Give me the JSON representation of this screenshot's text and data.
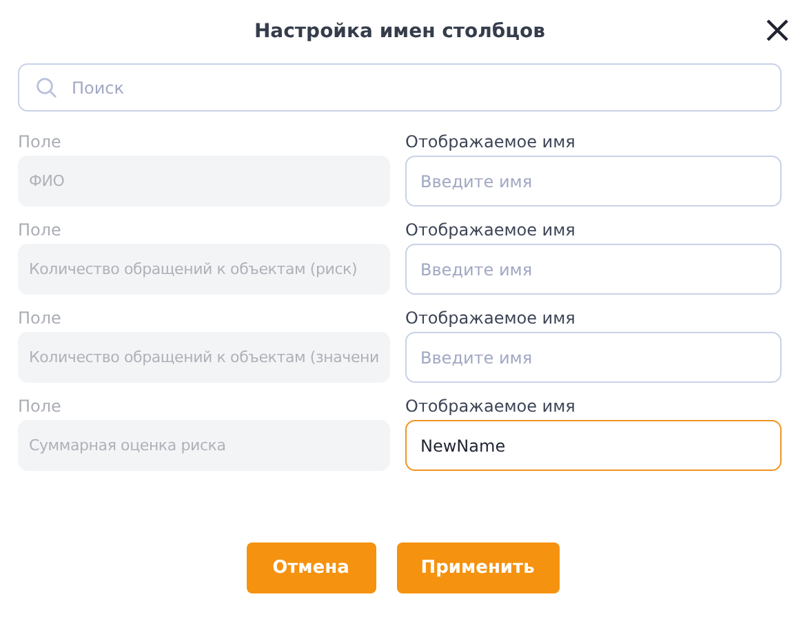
{
  "dialog": {
    "title": "Настройка имен столбцов"
  },
  "search": {
    "placeholder": "Поиск"
  },
  "rows": [
    {
      "field_label": "Поле",
      "field_value": "ФИО",
      "name_label": "Отображаемое имя",
      "placeholder": "Введите имя",
      "focused": false
    },
    {
      "field_label": "Поле",
      "field_value": "Количество обращений к объектам (риск)",
      "name_label": "Отображаемое имя",
      "placeholder": "Введите имя",
      "focused": false
    },
    {
      "field_label": "Поле",
      "field_value": "Количество обращений к объектам (значени",
      "name_label": "Отображаемое имя",
      "placeholder": "Введите имя",
      "focused": false
    },
    {
      "field_label": "Поле",
      "field_value": "Суммарная оценка риска",
      "name_label": "Отображаемое имя",
      "value": "NewName",
      "focused": true
    }
  ],
  "buttons": [
    {
      "label": "Отмена"
    },
    {
      "label": "Применить"
    }
  ]
}
